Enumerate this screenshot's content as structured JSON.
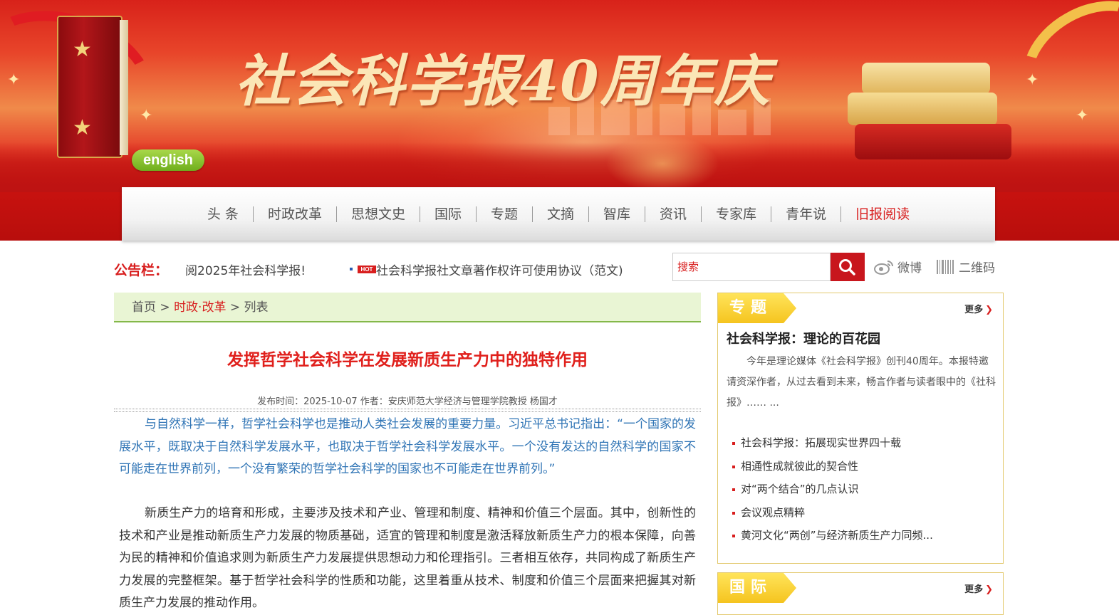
{
  "banner": {
    "title": "社会科学报40周年庆",
    "english_label": "english"
  },
  "nav": {
    "items": [
      "头 条",
      "时政改革",
      "思想文史",
      "国际",
      "专题",
      "文摘",
      "智库",
      "资讯",
      "专家库",
      "青年说"
    ],
    "old_paper": "旧报阅读"
  },
  "notice": {
    "label": "公告栏：",
    "text": "阅2025年社会科学报!",
    "hot_badge": "HOT",
    "link": "社会科学报社文章著作权许可使用协议（范文)"
  },
  "search": {
    "placeholder": "搜索"
  },
  "social": {
    "weibo": "微博",
    "qrcode": "二维码"
  },
  "breadcrumb": {
    "home": "首页",
    "sep": " > ",
    "section": "时政·改革",
    "list": "列表"
  },
  "article": {
    "title": "发挥哲学社会科学在发展新质生产力中的独特作用",
    "meta": "发布时间：2025-10-07 作者：安庆师范大学经济与管理学院教授 杨国才",
    "paragraphs": [
      "与自然科学一样，哲学社会科学也是推动人类社会发展的重要力量。习近平总书记指出：“一个国家的发展水平，既取决于自然科学发展水平，也取决于哲学社会科学发展水平。一个没有发达的自然科学的国家不可能走在世界前列，一个没有繁荣的哲学社会科学的国家也不可能走在世界前列。”",
      "新质生产力的培育和形成，主要涉及技术和产业、管理和制度、精神和价值三个层面。其中，创新性的技术和产业是推动新质生产力发展的物质基础，适宜的管理和制度是激活释放新质生产力的根本保障，向善为民的精神和价值追求则为新质生产力发展提供思想动力和伦理指引。三者相互依存，共同构成了新质生产力发展的完整框架。基于哲学社会科学的性质和功能，这里着重从技术、制度和价值三个层面来把握其对新质生产力发展的推动作用。"
    ]
  },
  "sidebar": {
    "special": {
      "tab": "专题",
      "more": "更多",
      "headline": "社会科学报：理论的百花园",
      "desc": "今年是理论媒体《社会科学报》创刊40周年。本报特邀请资深作者，从过去看到未来，畅言作者与读者眼中的《社科报》……   ...",
      "items": [
        "社会科学报：拓展现实世界四十载",
        "相通性成就彼此的契合性",
        "对“两个结合”的几点认识",
        "会议观点精粹",
        "黄河文化“两创”与经济新质生产力同频..."
      ]
    },
    "intl": {
      "tab": "国际",
      "more": "更多"
    }
  }
}
